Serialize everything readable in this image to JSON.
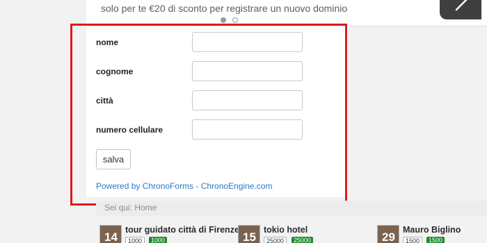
{
  "promo": {
    "text": "solo per te €20 di sconto per registrare un nuovo dominio"
  },
  "form": {
    "fields": [
      {
        "label": "nome",
        "value": ""
      },
      {
        "label": "cognome",
        "value": ""
      },
      {
        "label": "città",
        "value": ""
      },
      {
        "label": "numero cellulare",
        "value": ""
      }
    ],
    "save_label": "salva",
    "powered_by": "Powered by ChronoForms - ChronoEngine.com"
  },
  "breadcrumb": {
    "text": "Sei qui:  Home"
  },
  "items": [
    {
      "number": "14",
      "title": "tour guidato città di Firenze",
      "count": "1000",
      "score": "1000"
    },
    {
      "number": "15",
      "title": "tokio hotel",
      "count": "25000",
      "score": "25000"
    },
    {
      "number": "29",
      "title": "Mauro Biglino",
      "count": "1500",
      "score": "1500"
    }
  ],
  "colors": {
    "highlight": "#e01a1a",
    "link": "#2f78c4",
    "badge_green": "#1e8a2a"
  },
  "icons": {
    "next": "chevron-right-icon"
  }
}
